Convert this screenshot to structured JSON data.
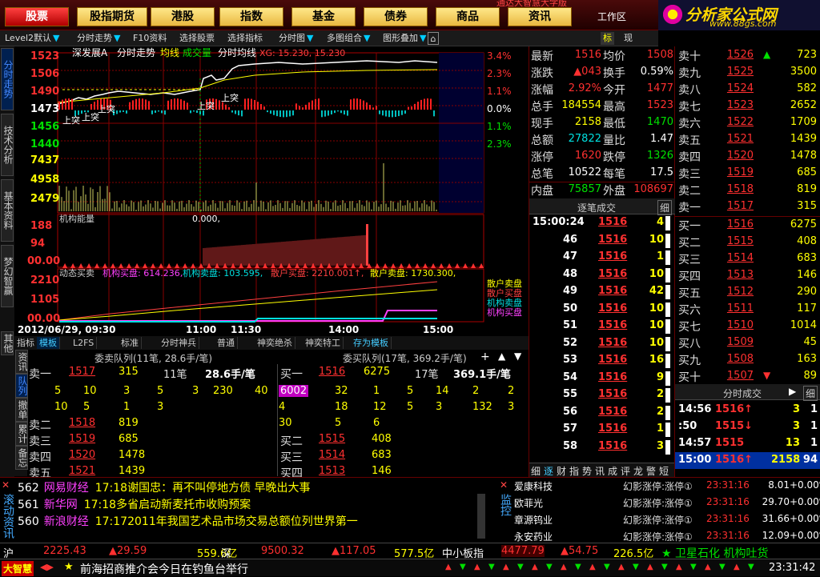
{
  "topbar": {
    "buttons": [
      "股票",
      "股指期货",
      "港股",
      "指数",
      "基金",
      "债券",
      "商品",
      "资讯"
    ],
    "workspace": "工作区",
    "marquee": "通达大智慧大学版",
    "logo_title": "分析家公式网",
    "logo_url": "www.88gs.com"
  },
  "toolbar": {
    "items": [
      "Level2默认",
      "分时走势",
      "F10资料",
      "选择股票",
      "选择指标",
      "分时图",
      "多图组合",
      "图形叠加"
    ],
    "right_tabs": [
      "标",
      "现"
    ]
  },
  "left_tabs": [
    "分时走势",
    "技术分析",
    "基本资料",
    "梦幻智赢"
  ],
  "left_tabs_bottom": [
    "其他"
  ],
  "chart": {
    "header_left": "深发展A",
    "header_items": [
      "分时走势",
      "均线",
      "成交量",
      "分时均线"
    ],
    "xg_label": "XG: 15.230, 15.230",
    "price_labels": [
      "1523",
      "1506",
      "1490",
      "1473",
      "1456",
      "1440"
    ],
    "pct_labels": [
      "3.4%",
      "2.3%",
      "1.1%",
      "0.0%",
      "1.1%",
      "2.3%"
    ],
    "vol_labels": [
      "7437",
      "4958",
      "2479"
    ],
    "signal_label": "上突",
    "inst_title": "机构能量",
    "inst_value": "0.000,",
    "inst_labels": [
      "188",
      "94",
      "00.00"
    ],
    "dyn_title": "动态买卖",
    "dyn_items": [
      {
        "text": "机构买盘: 614.236,",
        "color": "#ff40ff"
      },
      {
        "text": "机构卖盘: 103.595,",
        "color": "#00e0e0"
      },
      {
        "text": "散户买盘: 2210.001↑,",
        "color": "#ff4040"
      },
      {
        "text": "散户卖盘: 1730.300,",
        "color": "#ffff00"
      }
    ],
    "dyn_labels": [
      "2210",
      "1105",
      "00.00"
    ],
    "side_legend": [
      "散户卖盘",
      "散户买盘",
      "机构卖盘",
      "机构买盘"
    ],
    "time_labels": [
      "2012/06/29, 09:30",
      "11:00",
      "11:30",
      "14:00",
      "15:00"
    ]
  },
  "bottom_tabs": [
    "指标",
    "模板",
    "L2FS",
    "标准",
    "分时神兵",
    "普通",
    "神奕绝杀",
    "神奕特工",
    "存为模板"
  ],
  "queue": {
    "sell_title": "委卖队列(11笔, 28.6手/笔)",
    "buy_title": "委买队列(17笔, 369.2手/笔)",
    "side_tabs": [
      "资讯",
      "队列",
      "撤单",
      "累计",
      "备忘"
    ],
    "sell_top": {
      "label": "卖一",
      "price": "1517",
      "vol": "315",
      "count": "11笔",
      "avg": "28.6手/笔"
    },
    "sell_rows": [
      [
        "5",
        "10",
        "3",
        "5",
        "3",
        "230",
        "40"
      ],
      [
        "10",
        "5",
        "1",
        "3"
      ]
    ],
    "sell_levels": [
      {
        "label": "卖二",
        "price": "1518",
        "vol": "819"
      },
      {
        "label": "卖三",
        "price": "1519",
        "vol": "685"
      },
      {
        "label": "卖四",
        "price": "1520",
        "vol": "1478"
      },
      {
        "label": "卖五",
        "price": "1521",
        "vol": "1439"
      }
    ],
    "buy_top": {
      "label": "买一",
      "price": "1516",
      "vol": "6275",
      "count": "17笔",
      "avg": "369.1手/笔"
    },
    "buy_rows": [
      [
        "6002",
        "32",
        "1",
        "5",
        "14",
        "2",
        "2"
      ],
      [
        "4",
        "18",
        "12",
        "5",
        "3",
        "132",
        "3"
      ],
      [
        "30",
        "5",
        "6"
      ]
    ],
    "buy_levels": [
      {
        "label": "买二",
        "price": "1515",
        "vol": "408"
      },
      {
        "label": "买三",
        "price": "1514",
        "vol": "683"
      },
      {
        "label": "买四",
        "price": "1513",
        "vol": "146"
      }
    ]
  },
  "quote": {
    "rows": [
      {
        "l1": "最新",
        "v1": "1516",
        "c1": "#ff3030",
        "l2": "均价",
        "v2": "1508",
        "c2": "#ff3030"
      },
      {
        "l1": "涨跌",
        "v1": "▲043",
        "c1": "#ff3030",
        "l2": "换手",
        "v2": "0.59%",
        "c2": "#ffffff"
      },
      {
        "l1": "涨幅",
        "v1": "2.92%",
        "c1": "#ff3030",
        "l2": "今开",
        "v2": "1477",
        "c2": "#ff3030"
      },
      {
        "l1": "总手",
        "v1": "184554",
        "c1": "#ffff00",
        "l2": "最高",
        "v2": "1523",
        "c2": "#ff3030"
      },
      {
        "l1": "现手",
        "v1": "2158",
        "c1": "#ffff00",
        "l2": "最低",
        "v2": "1470",
        "c2": "#00e000"
      },
      {
        "l1": "总额",
        "v1": "27822",
        "c1": "#00e0e0",
        "l2": "量比",
        "v2": "1.47",
        "c2": "#ffffff"
      },
      {
        "l1": "涨停",
        "v1": "1620",
        "c1": "#ff3030",
        "l2": "跌停",
        "v2": "1326",
        "c2": "#00e000"
      },
      {
        "l1": "总笔",
        "v1": "10522",
        "c1": "#ffffff",
        "l2": "每笔",
        "v2": "17.5",
        "c2": "#ffffff"
      },
      {
        "l1": "内盘",
        "v1": "75857",
        "c1": "#00e000",
        "l2": "外盘",
        "v2": "108697",
        "c2": "#ff3030"
      }
    ]
  },
  "book": {
    "sells": [
      {
        "label": "卖十",
        "price": "1526",
        "vol": "723",
        "arrow": "▲"
      },
      {
        "label": "卖九",
        "price": "1525",
        "vol": "3500",
        "arrow": ""
      },
      {
        "label": "卖八",
        "price": "1524",
        "vol": "582",
        "arrow": ""
      },
      {
        "label": "卖七",
        "price": "1523",
        "vol": "2652",
        "arrow": ""
      },
      {
        "label": "卖六",
        "price": "1522",
        "vol": "1709",
        "arrow": ""
      },
      {
        "label": "卖五",
        "price": "1521",
        "vol": "1439",
        "arrow": ""
      },
      {
        "label": "卖四",
        "price": "1520",
        "vol": "1478",
        "arrow": ""
      },
      {
        "label": "卖三",
        "price": "1519",
        "vol": "685",
        "arrow": ""
      },
      {
        "label": "卖二",
        "price": "1518",
        "vol": "819",
        "arrow": ""
      },
      {
        "label": "卖一",
        "price": "1517",
        "vol": "315",
        "arrow": ""
      }
    ],
    "buys": [
      {
        "label": "买一",
        "price": "1516",
        "vol": "6275",
        "arrow": ""
      },
      {
        "label": "买二",
        "price": "1515",
        "vol": "408",
        "arrow": ""
      },
      {
        "label": "买三",
        "price": "1514",
        "vol": "683",
        "arrow": ""
      },
      {
        "label": "买四",
        "price": "1513",
        "vol": "146",
        "arrow": ""
      },
      {
        "label": "买五",
        "price": "1512",
        "vol": "290",
        "arrow": ""
      },
      {
        "label": "买六",
        "price": "1511",
        "vol": "117",
        "arrow": ""
      },
      {
        "label": "买七",
        "price": "1510",
        "vol": "1014",
        "arrow": ""
      },
      {
        "label": "买八",
        "price": "1509",
        "vol": "45",
        "arrow": ""
      },
      {
        "label": "买九",
        "price": "1508",
        "vol": "163",
        "arrow": ""
      },
      {
        "label": "买十",
        "price": "1507",
        "vol": "89",
        "arrow": "▼"
      }
    ]
  },
  "ticks": {
    "title": "逐笔成交",
    "detail_btn": "细",
    "rows": [
      {
        "t": "15:00:24",
        "p": "1516",
        "v": "4"
      },
      {
        "t": "46",
        "p": "1516",
        "v": "10"
      },
      {
        "t": "47",
        "p": "1516",
        "v": "1"
      },
      {
        "t": "48",
        "p": "1516",
        "v": "10"
      },
      {
        "t": "49",
        "p": "1516",
        "v": "42"
      },
      {
        "t": "50",
        "p": "1516",
        "v": "10"
      },
      {
        "t": "51",
        "p": "1516",
        "v": "10"
      },
      {
        "t": "52",
        "p": "1516",
        "v": "10"
      },
      {
        "t": "53",
        "p": "1516",
        "v": "16"
      },
      {
        "t": "54",
        "p": "1516",
        "v": "9"
      },
      {
        "t": "55",
        "p": "1516",
        "v": "2"
      },
      {
        "t": "56",
        "p": "1516",
        "v": "2"
      },
      {
        "t": "57",
        "p": "1516",
        "v": "1"
      },
      {
        "t": "58",
        "p": "1516",
        "v": "3"
      }
    ],
    "bottom_tabs": [
      "细",
      "逐",
      "财",
      "指",
      "势",
      "讯",
      "成",
      "评",
      "龙",
      "警",
      "短"
    ]
  },
  "deals": {
    "title": "分时成交",
    "detail_btn": "细",
    "rows": [
      {
        "t": "14:56",
        "p": "1516↑",
        "v": "3",
        "n": "1",
        "hl": false
      },
      {
        "t": ":50",
        "p": "1515↓",
        "v": "3",
        "n": "1",
        "hl": false
      },
      {
        "t": "14:57",
        "p": "1515",
        "v": "13",
        "n": "1",
        "hl": false
      },
      {
        "t": "15:00",
        "p": "1516↑",
        "v": "2158",
        "n": "94",
        "hl": true
      }
    ]
  },
  "news": {
    "side_label": "滚动资讯",
    "rows": [
      {
        "id": "562",
        "src": "网易财经",
        "time": "17:18",
        "text": "谢国忠：再不叫停地方债 早晚出大事"
      },
      {
        "id": "561",
        "src": "新华网",
        "time": "17:18",
        "text": "多省启动新麦托市收购预案"
      },
      {
        "id": "560",
        "src": "新浪财经",
        "time": "17:17",
        "text": "2011年我国艺术品市场交易总额位列世界第一"
      }
    ]
  },
  "monitor": {
    "side_label": "监控",
    "rows": [
      {
        "name": "爱康科技",
        "signal": "幻影涨停:涨停①",
        "time": "23:31:16",
        "val": "8.01",
        "chg": "+0.00%"
      },
      {
        "name": "欧菲光",
        "signal": "幻影涨停:涨停①",
        "time": "23:31:16",
        "val": "29.70",
        "chg": "+0.00%"
      },
      {
        "name": "章源钨业",
        "signal": "幻影涨停:涨停①",
        "time": "23:31:16",
        "val": "31.66",
        "chg": "+0.00%"
      },
      {
        "name": "永安药业",
        "signal": "幻影涨停:涨停①",
        "time": "23:31:16",
        "val": "12.09",
        "chg": "+0.00%"
      }
    ]
  },
  "indexbar": {
    "sh_label": "沪",
    "sh_val": "2225.43",
    "sh_chg": "▲29.59",
    "sh_amt": "559.6亿",
    "sz_label": "深",
    "sz_val": "9500.32",
    "sz_chg": "▲117.05",
    "sz_amt": "577.5亿",
    "zx_label": "中小板指",
    "zx_val": "4477.79",
    "zx_chg": "▲54.75",
    "zx_amt": "226.5亿",
    "ticker": "★ 卫星石化 机构吐货"
  },
  "statusbar": {
    "brand": "大智慧",
    "message": "前海招商推介会今日在钓鱼台举行",
    "clock": "23:31:42"
  }
}
